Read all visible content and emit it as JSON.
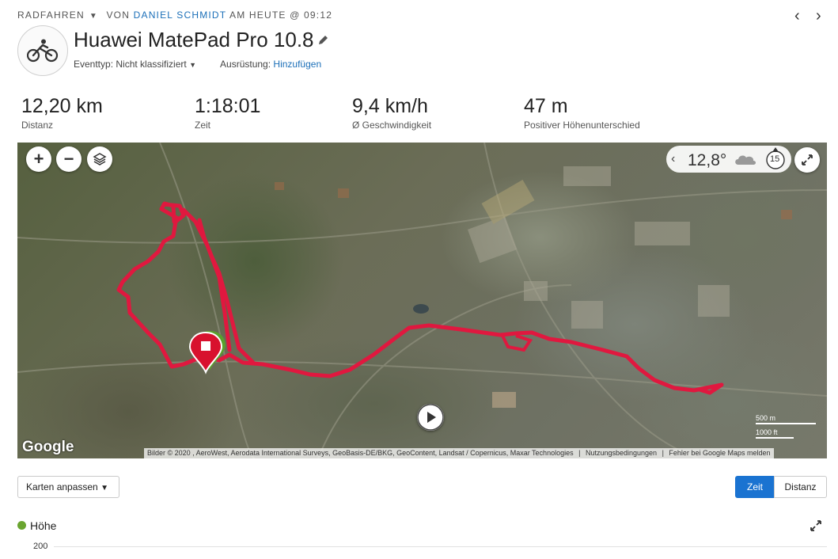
{
  "header": {
    "activity_type": "RADFAHREN",
    "by_label": "VON",
    "user_name": "DANIEL SCHMIDT",
    "date_text": "AM HEUTE @ 09:12",
    "title": "Huawei MatePad Pro 10.8",
    "event_type_label": "Eventtyp:",
    "event_type_value": "Nicht klassifiziert",
    "gear_label": "Ausrüstung:",
    "gear_link": "Hinzufügen"
  },
  "stats": [
    {
      "value": "12,20 km",
      "label": "Distanz"
    },
    {
      "value": "1:18:01",
      "label": "Zeit"
    },
    {
      "value": "9,4 km/h",
      "label": "Ø Geschwindigkeit"
    },
    {
      "value": "47 m",
      "label": "Positiver Höhenunterschied"
    }
  ],
  "map": {
    "zoom_in": "+",
    "zoom_out": "−",
    "temperature": "12,8°",
    "wind_speed": "15",
    "provider_logo": "Google",
    "attribution": "Bilder © 2020 , AeroWest, Aerodata International Surveys, GeoBasis-DE/BKG, GeoContent, Landsat / Copernicus, Maxar Technologies",
    "terms": "Nutzungsbedingungen",
    "report": "Fehler bei Google Maps melden",
    "scale_metric": "500 m",
    "scale_imperial": "1000 ft",
    "route_color": "#e0183f"
  },
  "controls": {
    "adjust_maps": "Karten anpassen",
    "toggle_time": "Zeit",
    "toggle_distance": "Distanz"
  },
  "elevation": {
    "title": "Höhe",
    "y_tick_top": "200",
    "series_color": "#6aa530"
  }
}
